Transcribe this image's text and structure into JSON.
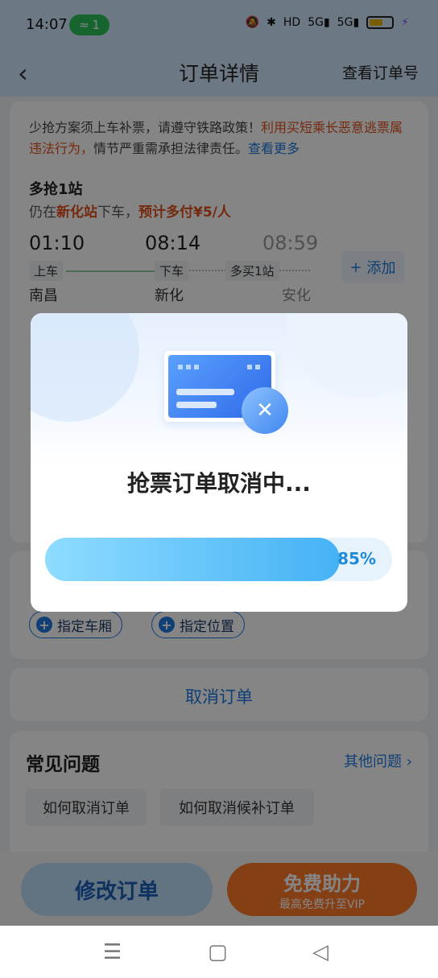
{
  "status_bar": {
    "time": "14:07",
    "hotspot_count": "1",
    "network_labels": [
      "HD",
      "5G",
      "5G"
    ],
    "icons": [
      "mute-icon",
      "bluetooth-icon",
      "hd-icon",
      "signal-icon",
      "battery-icon",
      "charging-icon"
    ]
  },
  "header": {
    "back_icon": "chevron-left-icon",
    "title": "订单详情",
    "right_action": "查看订单号"
  },
  "notice": {
    "text_plain": "少抢方案须上车补票，请遵守铁路政策！",
    "text_warning": "利用买短乘长恶意逃票属违法行为，",
    "text_plain2": "情节严重需承担法律责任。",
    "text_link": "查看更多"
  },
  "route": {
    "section_title": "多抢1站",
    "hint_prefix": "仍在",
    "hint_station": "新化站",
    "hint_mid": "下车，",
    "hint_cost": "预计多付¥5/人",
    "times": [
      "01:10",
      "08:14",
      "08:59"
    ],
    "tags": [
      "上车",
      "下车",
      "多买1站"
    ],
    "stations": [
      "南昌",
      "新化",
      "安化"
    ],
    "add_button": "添加",
    "add_icon": "plus-icon"
  },
  "options": {
    "chip_carriage": "指定车厢",
    "chip_seat": "指定位置"
  },
  "cancel_order_link": "取消订单",
  "faq": {
    "title": "常见问题",
    "more": "其他问题",
    "more_icon": "chevron-right-icon",
    "items": [
      "如何取消订单",
      "如何取消候补订单"
    ]
  },
  "bottom_bar": {
    "modify_button": "修改订单",
    "free_button": "免费助力",
    "free_subtitle": "最高免费升至VIP"
  },
  "nav_bar": {
    "icons": [
      "menu-icon",
      "home-icon",
      "back-icon"
    ]
  },
  "modal": {
    "illustration": "ticket-card-cancel-icon",
    "title": "抢票订单取消中...",
    "progress_fraction": 0.85,
    "progress_label": "85%"
  },
  "colors": {
    "accent_blue": "#1e7ae0",
    "warning_orange": "#e0501e",
    "progress_start": "#8fdcff",
    "progress_end": "#45b2f5",
    "free_button": "#ff7a2a"
  }
}
